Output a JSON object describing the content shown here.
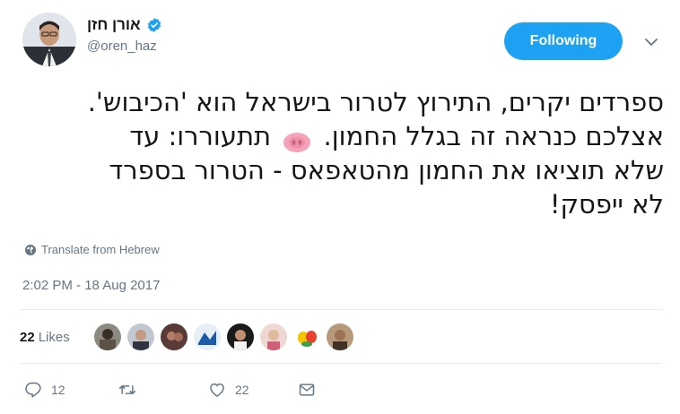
{
  "user": {
    "display_name": "אורן חזן",
    "handle": "@oren_haz",
    "verified": true
  },
  "follow_button": {
    "label": "Following",
    "color": "#1da1f2"
  },
  "tweet": {
    "line1": "ספרדים יקרים, התירוץ לטרור בישראל הוא 'הכיבוש'.",
    "line2_before": "אצלכם כנראה זה בגלל החמון.",
    "line2_after": "תתעוררו: עד",
    "line3": "שלא תוציאו את החמון מהטאפאס - הטרור בספרד",
    "line4": "לא ייפסק!",
    "emoji": "pig-nose"
  },
  "translate": {
    "label": "Translate from Hebrew",
    "icon": "globe-icon"
  },
  "timestamp": "2:02 PM - 18 Aug 2017",
  "likes": {
    "count": "22",
    "label": "Likes"
  },
  "actions": {
    "reply_count": "12",
    "retweet_count": "",
    "like_count": "22"
  },
  "colors": {
    "secondary_text": "#657786",
    "divider": "#e6ecf0",
    "brand": "#1da1f2"
  }
}
